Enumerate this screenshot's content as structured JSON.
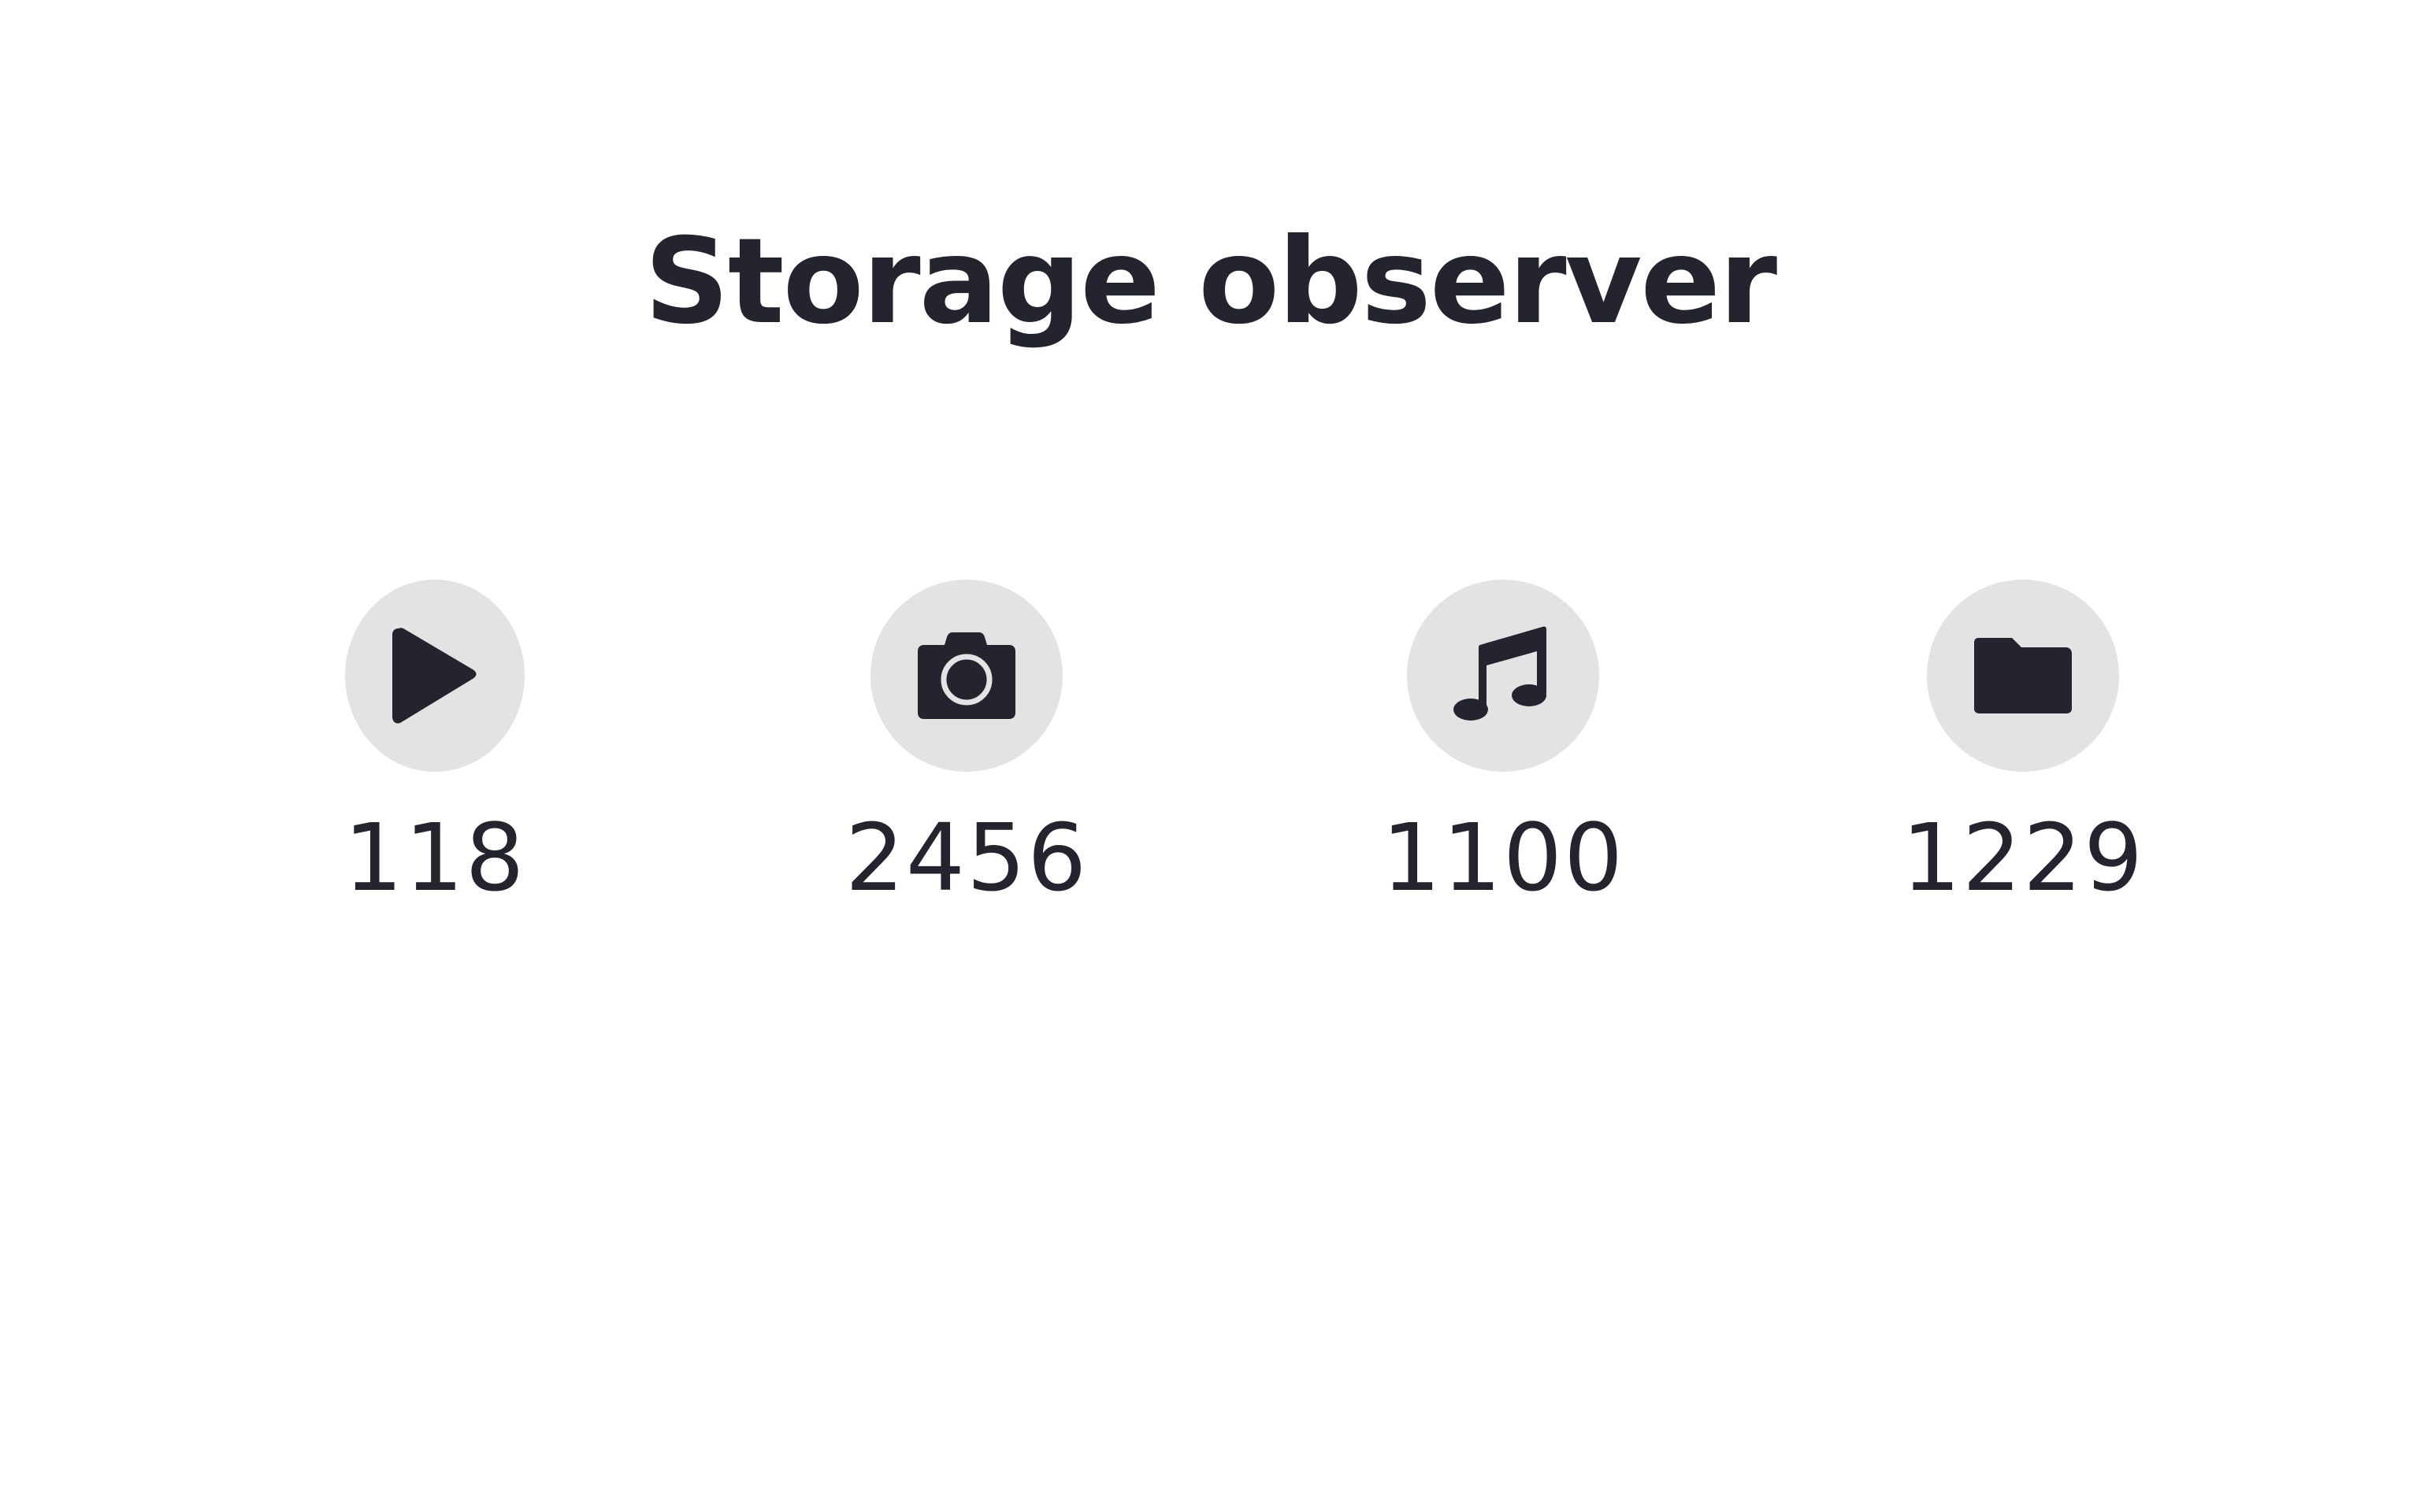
{
  "title": "Storage observer",
  "colors": {
    "text": "#24242e",
    "icon": "#24242e",
    "icon_background": "#e3e3e3",
    "background": "#ffffff"
  },
  "stats": [
    {
      "icon": "play-icon",
      "count": "118"
    },
    {
      "icon": "camera-icon",
      "count": "2456"
    },
    {
      "icon": "music-note-icon",
      "count": "1100"
    },
    {
      "icon": "folder-icon",
      "count": "1229"
    }
  ]
}
